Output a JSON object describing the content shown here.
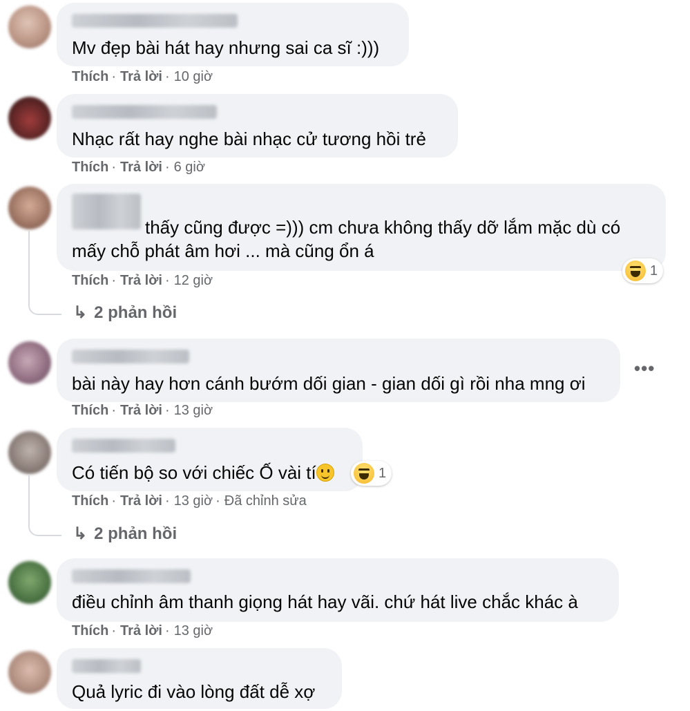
{
  "comments": [
    {
      "text": "Mv đẹp bài hát hay nhưng sai ca sĩ :)))",
      "like": "Thích",
      "reply": "Trả lời",
      "time": "10 giờ",
      "avatar_color": "#c9a89a"
    },
    {
      "text": "Nhạc rất hay nghe bài nhạc cử tương hồi trẻ",
      "like": "Thích",
      "reply": "Trả lời",
      "time": "6 giờ",
      "avatar_color": "#8a3a3a"
    },
    {
      "text_line1": "thấy cũng được =))) cm chưa không thấy dỡ lắm mặc dù có",
      "text_line2": "mấy chỗ phát âm hơi ... mà cũng ổn á",
      "like": "Thích",
      "reply": "Trả lời",
      "time": "12 giờ",
      "reaction_count": "1",
      "replies_label": "2 phản hồi",
      "avatar_color": "#b8907a"
    },
    {
      "text": "bài này hay hơn cánh bướm dối gian - gian dối gì rồi nha mng ơi",
      "like": "Thích",
      "reply": "Trả lời",
      "time": "13 giờ",
      "more": "•••",
      "avatar_color": "#9b7b8c"
    },
    {
      "text": "Có tiến bộ so với chiếc Ố vài tí",
      "like": "Thích",
      "reply": "Trả lời",
      "time": "13 giờ",
      "edited": "Đã chỉnh sửa",
      "reaction_count": "1",
      "replies_label": "2 phản hồi",
      "avatar_color": "#8f8580"
    },
    {
      "text": "điều chỉnh âm thanh giọng hát hay vãi. chứ hát live chắc khác à",
      "like": "Thích",
      "reply": "Trả lời",
      "time": "13 giờ",
      "avatar_color": "#4f7a46"
    },
    {
      "text": "Quả lyric đi vào lòng đất dễ xợ",
      "avatar_color": "#c4a392"
    }
  ],
  "colors": {
    "bubble": "#f0f2f5",
    "meta": "#65676b",
    "text": "#050505"
  }
}
